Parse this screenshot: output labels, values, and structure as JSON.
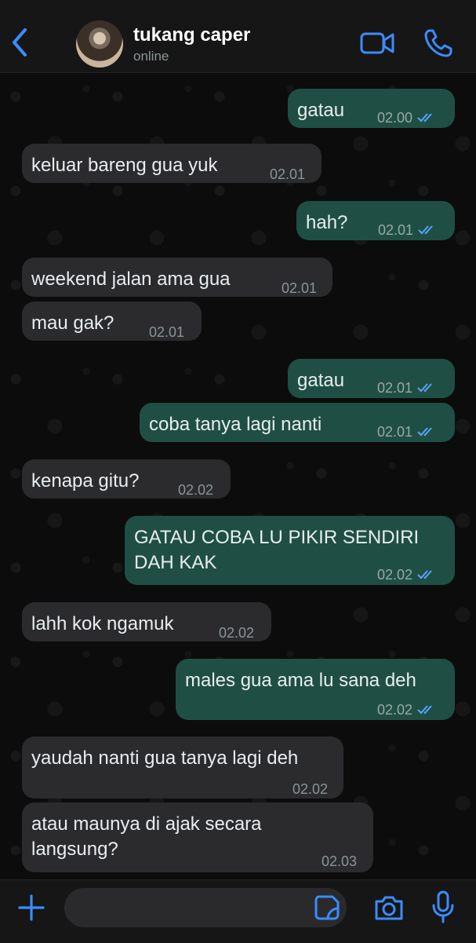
{
  "header": {
    "contact_name": "tukang caper",
    "status": "online",
    "icons": [
      "back-chevron-icon",
      "avatar",
      "video-call-icon",
      "voice-call-icon"
    ]
  },
  "colors": {
    "accent": "#3b8cff",
    "incoming_bubble": "#2b2b2d",
    "outgoing_bubble": "#1f4f44",
    "read_ticks": "#5aa2ff"
  },
  "messages": [
    {
      "dir": "out",
      "text": "gatau",
      "time": "02.00",
      "read": true
    },
    {
      "dir": "in",
      "text": "keluar bareng gua yuk",
      "time": "02.01"
    },
    {
      "dir": "out",
      "text": "hah?",
      "time": "02.01",
      "read": true
    },
    {
      "dir": "in",
      "text": "weekend jalan ama gua",
      "time": "02.01"
    },
    {
      "dir": "in",
      "text": "mau gak?",
      "time": "02.01"
    },
    {
      "dir": "out",
      "text": "gatau",
      "time": "02.01",
      "read": true
    },
    {
      "dir": "out",
      "text": "coba tanya lagi nanti",
      "time": "02.01",
      "read": true
    },
    {
      "dir": "in",
      "text": "kenapa gitu?",
      "time": "02.02"
    },
    {
      "dir": "out",
      "text": "GATAU COBA LU PIKIR SENDIRI",
      "text2": "DAH KAK",
      "time": "02.02",
      "read": true
    },
    {
      "dir": "in",
      "text": "lahh kok ngamuk",
      "time": "02.02"
    },
    {
      "dir": "out",
      "text": "males gua ama lu sana deh",
      "time": "02.02",
      "read": true
    },
    {
      "dir": "in",
      "text": "yaudah nanti gua tanya lagi deh",
      "time": "02.02"
    },
    {
      "dir": "in",
      "text": "atau maunya di ajak secara",
      "text2": "langsung?",
      "time": "02.03"
    }
  ],
  "input_bar": {
    "placeholder": "",
    "icons": [
      "plus-icon",
      "sticker-icon",
      "camera-icon",
      "microphone-icon"
    ]
  }
}
